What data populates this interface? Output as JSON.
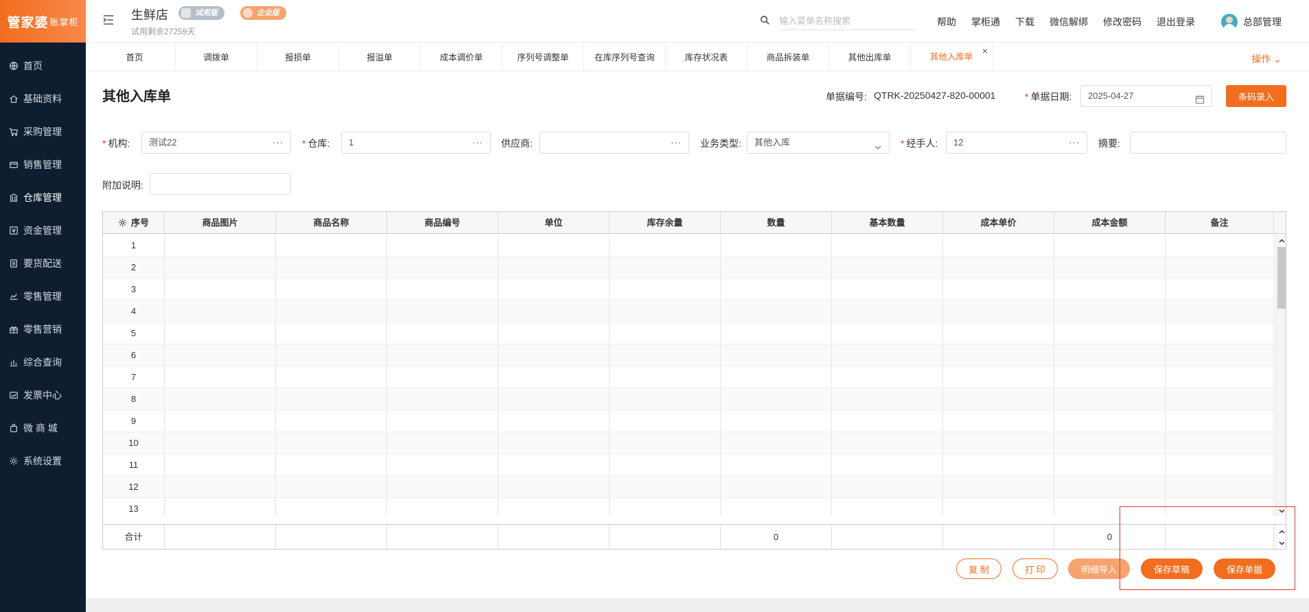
{
  "logo": {
    "main": "管家婆",
    "sub": "账掌柜"
  },
  "sidebar": {
    "items": [
      {
        "label": "首页",
        "icon": "globe-icon"
      },
      {
        "label": "基础资料",
        "icon": "home-icon"
      },
      {
        "label": "采购管理",
        "icon": "cart-icon"
      },
      {
        "label": "销售管理",
        "icon": "wallet-icon"
      },
      {
        "label": "仓库管理",
        "icon": "bank-icon",
        "active": true
      },
      {
        "label": "资金管理",
        "icon": "yuan-icon"
      },
      {
        "label": "要货配送",
        "icon": "list-icon"
      },
      {
        "label": "零售管理",
        "icon": "chart-icon"
      },
      {
        "label": "零售营销",
        "icon": "gift-icon"
      },
      {
        "label": "综合查询",
        "icon": "bar-chart-icon"
      },
      {
        "label": "发票中心",
        "icon": "trend-icon"
      },
      {
        "label": "微 商 城",
        "icon": "bag-icon"
      },
      {
        "label": "系统设置",
        "icon": "gear-icon"
      }
    ]
  },
  "header": {
    "store_name": "生鲜店",
    "badge_trial": "试用版",
    "badge_enterprise": "企业版",
    "trial_days": "试用剩余27259天",
    "search_placeholder": "输入菜单名称搜索",
    "links": [
      "帮助",
      "掌柜通",
      "下载",
      "微信解绑",
      "修改密码",
      "退出登录"
    ],
    "user_name": "总部管理"
  },
  "tabs": {
    "items": [
      "首页",
      "调拨单",
      "报损单",
      "报溢单",
      "成本调价单",
      "序列号调整单",
      "在库序列号查询",
      "库存状况表",
      "商品拆装单",
      "其他出库单",
      "其他入库单"
    ],
    "active_index": 10,
    "close_symbol": "×",
    "ops_label": "操作 ⌄"
  },
  "form": {
    "title": "其他入库单",
    "doc_no_label": "单据编号:",
    "doc_no": "QTRK-20250427-820-00001",
    "doc_date_label": "单据日期:",
    "doc_date": "2025-04-27",
    "barcode_button": "条码录入",
    "org_label": "机构:",
    "org_value": "测试22",
    "warehouse_label": "仓库:",
    "warehouse_value": "1",
    "supplier_label": "供应商:",
    "supplier_value": "",
    "biz_type_label": "业务类型:",
    "biz_type_value": "其他入库",
    "handler_label": "经手人:",
    "handler_value": "12",
    "summary_label": "摘要:",
    "summary_value": "",
    "remark_label": "附加说明:",
    "remark_value": "",
    "dots": "···",
    "required_mark": "*"
  },
  "table": {
    "columns": [
      "序号",
      "商品图片",
      "商品名称",
      "商品编号",
      "单位",
      "库存余量",
      "数量",
      "基本数量",
      "成本单价",
      "成本金额",
      "备注"
    ],
    "rows": [
      "1",
      "2",
      "3",
      "4",
      "5",
      "6",
      "7",
      "8",
      "9",
      "10",
      "11",
      "12",
      "13"
    ],
    "footer": {
      "label": "合计",
      "qty_total": "0",
      "amount_total": "0"
    }
  },
  "actions": {
    "copy": "复 制",
    "print": "打 印",
    "import": "明细导入",
    "save_draft": "保存草稿",
    "save_doc": "保存单据"
  },
  "colors": {
    "accent": "#f36d1f",
    "sidebar_bg": "#0f1d30",
    "highlight": "#e3342f"
  }
}
